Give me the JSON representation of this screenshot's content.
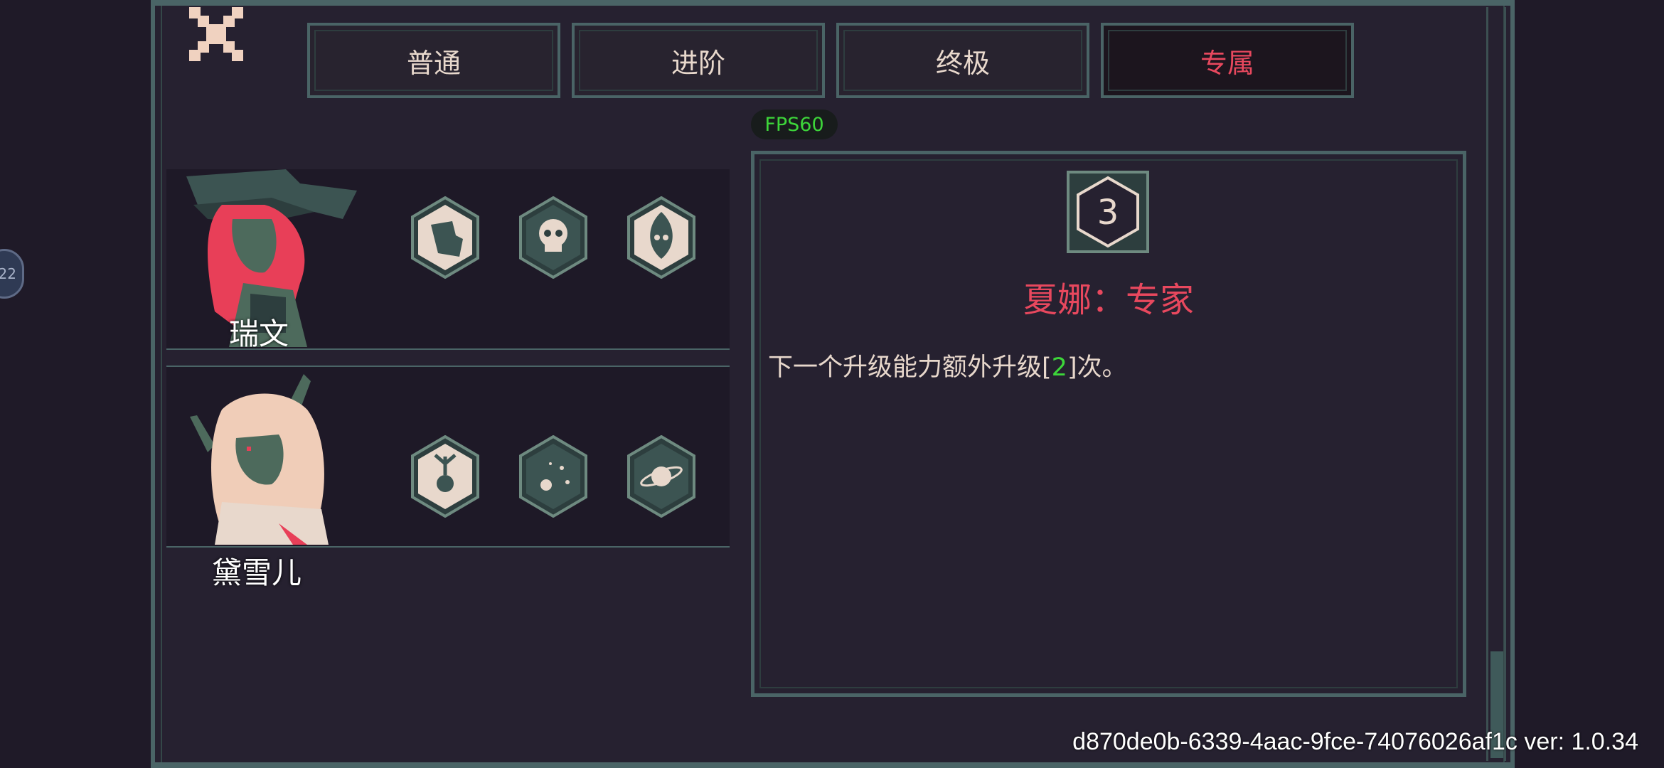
{
  "tabs": [
    {
      "label": "普通"
    },
    {
      "label": "进阶"
    },
    {
      "label": "终极"
    },
    {
      "label": "专属"
    }
  ],
  "active_tab": "专属",
  "fps_label": "FPS60",
  "characters": [
    {
      "name": "瑞文",
      "icons": [
        "silhouette-icon",
        "skull-icon",
        "flame-skull-icon"
      ]
    },
    {
      "name": "黛雪儿",
      "icons": [
        "antler-sprout-icon",
        "meteor-icon",
        "planet-icon"
      ]
    }
  ],
  "detail": {
    "badge_number": "3",
    "title": "夏娜：专家",
    "description_before": "下一个升级能力额外升级[",
    "description_value": "2",
    "description_after": "]次。"
  },
  "float_button_label": "22",
  "version_text": "d870de0b-6339-4aac-9fce-74076026af1c ver: 1.0.34",
  "colors": {
    "background": "#262130",
    "frame": "#4a6466",
    "accent_red": "#e8485e",
    "highlight_green": "#3dd63a",
    "text": "#e8d8cc"
  }
}
